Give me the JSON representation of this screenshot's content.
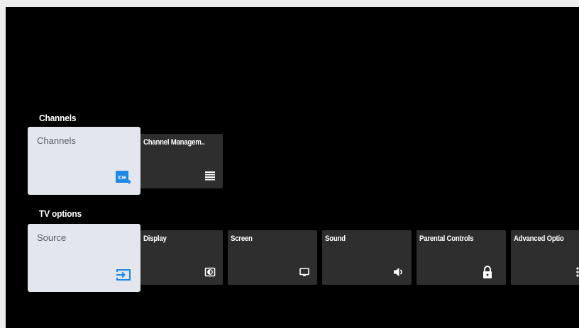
{
  "sections": {
    "channels": {
      "title": "Channels",
      "focused_tile": {
        "label": "Channels",
        "icon": "channel-add-icon"
      },
      "tiles": [
        {
          "label": "Channel Managem..",
          "icon": "list-icon"
        }
      ]
    },
    "tv_options": {
      "title": "TV options",
      "focused_tile": {
        "label": "Source",
        "icon": "input-source-icon"
      },
      "tiles": [
        {
          "label": "Display",
          "icon": "display-icon"
        },
        {
          "label": "Screen",
          "icon": "screen-icon"
        },
        {
          "label": "Sound",
          "icon": "speaker-icon"
        },
        {
          "label": "Parental Controls",
          "icon": "lock-icon"
        },
        {
          "label": "Advanced Optio",
          "icon": "more-vertical-icon"
        }
      ]
    }
  },
  "colors": {
    "screen_bg": "#000000",
    "tile_bg": "#2e2e2e",
    "focused_tile_bg": "#e4e6ee",
    "accent": "#1e88e5"
  }
}
